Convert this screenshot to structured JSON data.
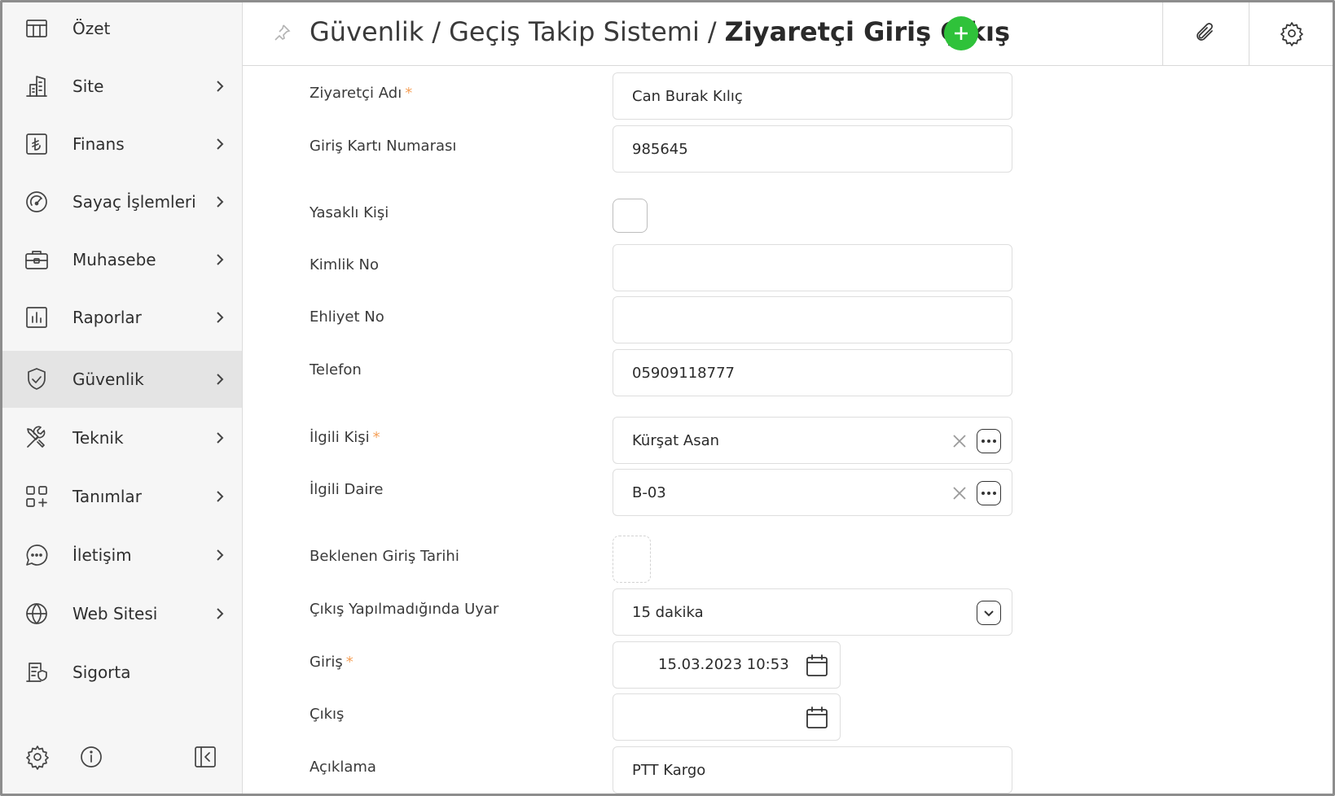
{
  "sidebar": {
    "items": [
      {
        "label": "Özet",
        "icon": "table-icon",
        "chevron": false,
        "active": false
      },
      {
        "label": "Site",
        "icon": "buildings-icon",
        "chevron": true,
        "active": false
      },
      {
        "label": "Finans",
        "icon": "lira-icon",
        "chevron": true,
        "active": false
      },
      {
        "label": "Sayaç İşlemleri",
        "icon": "gauge-icon",
        "chevron": true,
        "active": false
      },
      {
        "label": "Muhasebe",
        "icon": "briefcase-icon",
        "chevron": true,
        "active": false
      },
      {
        "label": "Raporlar",
        "icon": "bar-chart-icon",
        "chevron": true,
        "active": false
      },
      {
        "label": "Güvenlik",
        "icon": "shield-check-icon",
        "chevron": true,
        "active": true
      },
      {
        "label": "Teknik",
        "icon": "tools-icon",
        "chevron": true,
        "active": false
      },
      {
        "label": "Tanımlar",
        "icon": "grid-plus-icon",
        "chevron": true,
        "active": false
      },
      {
        "label": "İletişim",
        "icon": "chat-icon",
        "chevron": true,
        "active": false
      },
      {
        "label": "Web Sitesi",
        "icon": "globe-icon",
        "chevron": true,
        "active": false
      },
      {
        "label": "Sigorta",
        "icon": "insurance-icon",
        "chevron": false,
        "active": false
      }
    ],
    "footer_icons": [
      "gear-icon",
      "info-icon",
      "collapse-sidebar-icon"
    ]
  },
  "header": {
    "breadcrumb": [
      "Güvenlik",
      "Geçiş Takip Sistemi"
    ],
    "separator": "/",
    "title": "Ziyaretçi Giriş Çıkış",
    "actions": [
      "paperclip-icon",
      "gear-icon"
    ],
    "accent_color": "#2fc23a"
  },
  "form": {
    "required_mark": "*",
    "ziyaretci_adi": {
      "label": "Ziyaretçi Adı",
      "value": "Can Burak Kılıç",
      "required": true
    },
    "giris_karti": {
      "label": "Giriş Kartı Numarası",
      "value": "985645"
    },
    "yasakli_kisi": {
      "label": "Yasaklı Kişi",
      "checked": false
    },
    "kimlik_no": {
      "label": "Kimlik No",
      "value": ""
    },
    "ehliyet_no": {
      "label": "Ehliyet No",
      "value": ""
    },
    "telefon": {
      "label": "Telefon",
      "value": "05909118777"
    },
    "ilgili_kisi": {
      "label": "İlgili Kişi",
      "value": "Kürşat Asan",
      "required": true
    },
    "ilgili_daire": {
      "label": "İlgili Daire",
      "value": "B-03"
    },
    "beklenen_giris": {
      "label": "Beklenen Giriş Tarihi",
      "checked": false
    },
    "cikis_uyar": {
      "label": "Çıkış Yapılmadığında Uyar",
      "value": "15 dakika"
    },
    "giris": {
      "label": "Giriş",
      "value": "15.03.2023 10:53",
      "required": true
    },
    "cikis": {
      "label": "Çıkış",
      "value": ""
    },
    "aciklama": {
      "label": "Açıklama",
      "value": "PTT Kargo"
    }
  }
}
